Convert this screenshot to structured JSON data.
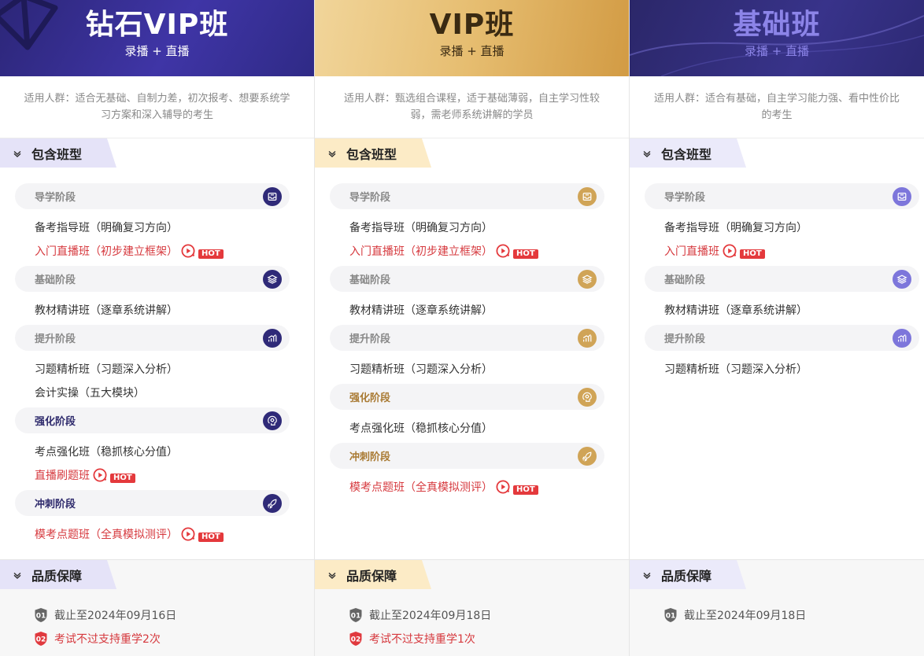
{
  "columns": [
    {
      "key": "diamond",
      "title": "钻石VIP班",
      "subtitle": "录播 + 直播",
      "suitable": "适用人群：适合无基础、自制力差，初次报考、想要系统学习方案和深入辅导的考生",
      "section_label": "包含班型",
      "stages": [
        {
          "name": "导学阶段",
          "icon": "inbox-icon",
          "style": "plain",
          "courses": [
            {
              "text": "备考指导班（明确复习方向）",
              "hot": false,
              "red": false
            },
            {
              "text": "入门直播班（初步建立框架）",
              "hot": true,
              "red": true,
              "badge": "HOT"
            }
          ]
        },
        {
          "name": "基础阶段",
          "icon": "layers-icon",
          "style": "plain",
          "courses": [
            {
              "text": "教材精讲班（逐章系统讲解）",
              "hot": false,
              "red": false
            }
          ]
        },
        {
          "name": "提升阶段",
          "icon": "chart-icon",
          "style": "plain",
          "courses": [
            {
              "text": "习题精析班（习题深入分析）",
              "hot": false,
              "red": false
            },
            {
              "text": "会计实操（五大模块）",
              "hot": false,
              "red": false
            }
          ]
        },
        {
          "name": "强化阶段",
          "icon": "brain-icon",
          "style": "dark",
          "courses": [
            {
              "text": "考点强化班（稳抓核心分值）",
              "hot": false,
              "red": false
            },
            {
              "text": "直播刷题班",
              "hot": true,
              "red": true,
              "badge": "HOT"
            }
          ]
        },
        {
          "name": "冲刺阶段",
          "icon": "rocket-icon",
          "style": "dark",
          "courses": [
            {
              "text": "模考点题班（全真模拟测评）",
              "hot": true,
              "red": true,
              "badge": "HOT"
            }
          ]
        }
      ],
      "quality_label": "品质保障",
      "quality": [
        {
          "num": "01",
          "text": "截止至2024年09月16日",
          "red": false
        },
        {
          "num": "02",
          "text": "考试不过支持重学2次",
          "red": true
        }
      ]
    },
    {
      "key": "vip",
      "title": "VIP班",
      "subtitle": "录播 + 直播",
      "suitable": "适用人群：甄选组合课程，适于基础薄弱，自主学习性较弱，需老师系统讲解的学员",
      "section_label": "包含班型",
      "stages": [
        {
          "name": "导学阶段",
          "icon": "inbox-icon",
          "style": "plain",
          "courses": [
            {
              "text": "备考指导班（明确复习方向）",
              "hot": false,
              "red": false
            },
            {
              "text": "入门直播班（初步建立框架）",
              "hot": true,
              "red": true,
              "badge": "HOT"
            }
          ]
        },
        {
          "name": "基础阶段",
          "icon": "layers-icon",
          "style": "plain",
          "courses": [
            {
              "text": "教材精讲班（逐章系统讲解）",
              "hot": false,
              "red": false
            }
          ]
        },
        {
          "name": "提升阶段",
          "icon": "chart-icon",
          "style": "plain",
          "courses": [
            {
              "text": "习题精析班（习题深入分析）",
              "hot": false,
              "red": false
            }
          ]
        },
        {
          "name": "强化阶段",
          "icon": "brain-icon",
          "style": "gold",
          "courses": [
            {
              "text": "考点强化班（稳抓核心分值）",
              "hot": false,
              "red": false
            }
          ]
        },
        {
          "name": "冲刺阶段",
          "icon": "rocket-icon",
          "style": "gold",
          "courses": [
            {
              "text": "模考点题班（全真模拟测评）",
              "hot": true,
              "red": true,
              "badge": "HOT"
            }
          ]
        }
      ],
      "quality_label": "品质保障",
      "quality": [
        {
          "num": "01",
          "text": "截止至2024年09月18日",
          "red": false
        },
        {
          "num": "02",
          "text": "考试不过支持重学1次",
          "red": true
        }
      ]
    },
    {
      "key": "basic",
      "title": "基础班",
      "subtitle": "录播 + 直播",
      "suitable": "适用人群：适合有基础，自主学习能力强、看中性价比的考生",
      "section_label": "包含班型",
      "stages": [
        {
          "name": "导学阶段",
          "icon": "inbox-icon",
          "style": "plain",
          "courses": [
            {
              "text": "备考指导班（明确复习方向）",
              "hot": false,
              "red": false
            },
            {
              "text": "入门直播班",
              "hot": true,
              "red": true,
              "badge": "HOT"
            }
          ]
        },
        {
          "name": "基础阶段",
          "icon": "layers-icon",
          "style": "plain",
          "courses": [
            {
              "text": "教材精讲班（逐章系统讲解）",
              "hot": false,
              "red": false
            }
          ]
        },
        {
          "name": "提升阶段",
          "icon": "chart-icon",
          "style": "plain",
          "courses": [
            {
              "text": "习题精析班（习题深入分析）",
              "hot": false,
              "red": false
            }
          ]
        }
      ],
      "quality_label": "品质保障",
      "quality": [
        {
          "num": "01",
          "text": "截止至2024年09月18日",
          "red": false
        }
      ]
    }
  ],
  "colors": {
    "diamond_accent": "#2f2a78",
    "vip_accent": "#d0a457",
    "basic_accent": "#7d76db",
    "hot_red": "#e4393c",
    "course_red": "#d6393e"
  }
}
